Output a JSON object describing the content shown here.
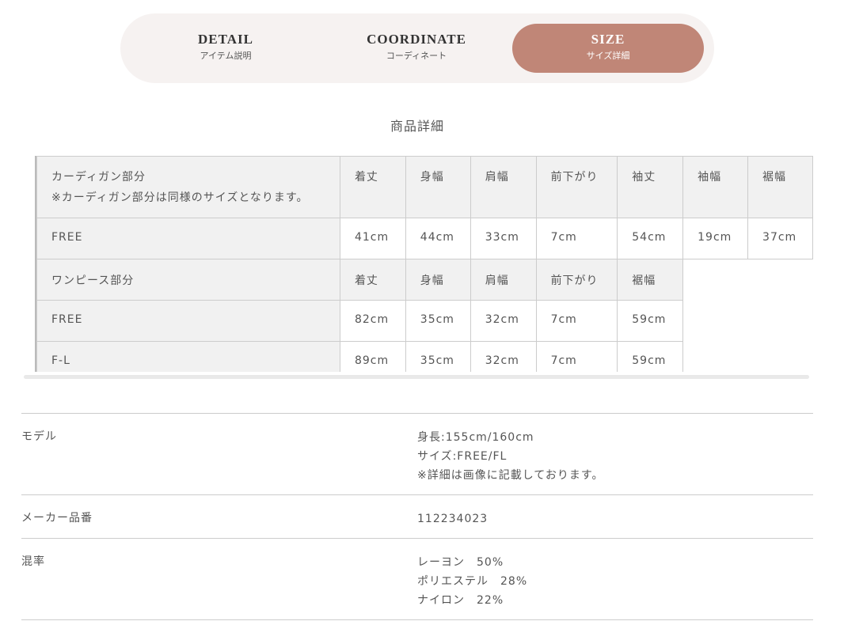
{
  "tabs": [
    {
      "en": "DETAIL",
      "jp": "アイテム説明",
      "active": false
    },
    {
      "en": "COORDINATE",
      "jp": "コーディネート",
      "active": false
    },
    {
      "en": "SIZE",
      "jp": "サイズ詳細",
      "active": true
    }
  ],
  "accent_color": "#c08677",
  "section_title": "商品詳細",
  "size_table": {
    "rows": [
      {
        "type": "header",
        "cells": [
          "カーディガン部分\n※カーディガン部分は同様のサイズとなります。",
          "着丈",
          "身幅",
          "肩幅",
          "前下がり",
          "袖丈",
          "袖幅",
          "裾幅"
        ]
      },
      {
        "type": "value",
        "cells": [
          "FREE",
          "41cm",
          "44cm",
          "33cm",
          "7cm",
          "54cm",
          "19cm",
          "37cm"
        ]
      },
      {
        "type": "header",
        "cells": [
          "ワンピース部分",
          "着丈",
          "身幅",
          "肩幅",
          "前下がり",
          "裾幅"
        ]
      },
      {
        "type": "value",
        "cells": [
          "FREE",
          "82cm",
          "35cm",
          "32cm",
          "7cm",
          "59cm"
        ]
      },
      {
        "type": "value",
        "cells": [
          "F-L",
          "89cm",
          "35cm",
          "32cm",
          "7cm",
          "59cm"
        ]
      }
    ]
  },
  "details": [
    {
      "label": "モデル",
      "values": [
        "身長:155cm/160cm",
        "サイズ:FREE/FL",
        "※詳細は画像に記載しております。"
      ]
    },
    {
      "label": "メーカー品番",
      "values": [
        "112234023"
      ]
    },
    {
      "label": "混率",
      "values": [
        "レーヨン　50%",
        "ポリエステル　28%",
        "ナイロン　22%"
      ]
    }
  ]
}
